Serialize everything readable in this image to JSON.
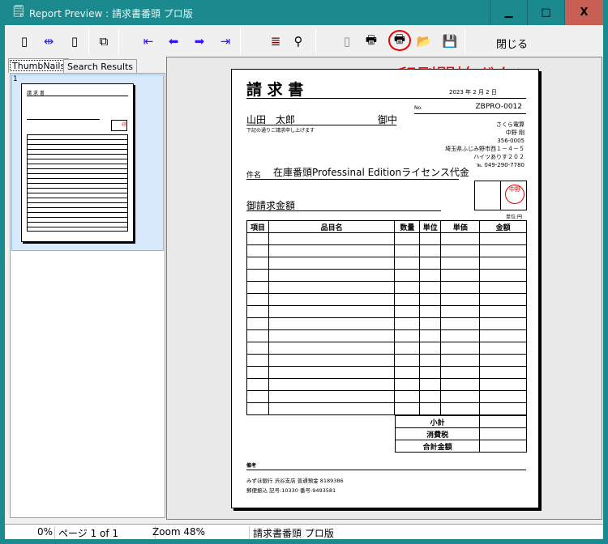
{
  "window": {
    "title": "Report Preview : 請求書番頭 プロ版",
    "minimize": "▁",
    "maximize": "□",
    "close": "X"
  },
  "toolbar": {
    "close_label": "閉じる",
    "annotation": "印刷開始ボタン",
    "annotation_color": "#ff0000"
  },
  "tabs": [
    {
      "label": "ThumbNails"
    },
    {
      "label": "Search Results"
    }
  ],
  "thumbnail": {
    "page_number": "1"
  },
  "invoice": {
    "title": "請 求 書",
    "date": "2023 年  2  月  2  日",
    "no_label": "No.",
    "no_value": "ZBPRO-0012",
    "customer": "山田　太郎",
    "honorific": "御中",
    "note": "下記の通りご請求申し上げます",
    "issuer": [
      "さくら電算",
      "中野 剛",
      "356-0005",
      "埼玉県ふじみ野市西１－４－５",
      "ハイツありす２０２",
      "℡ 049-290-7780"
    ],
    "stamp": "中野",
    "subject_label": "件名",
    "subject": "在庫番頭Professinal Editionライセンス代金",
    "amount_label": "御請求金額",
    "unit": "単位:円",
    "columns": [
      "項目",
      "品目名",
      "数量",
      "単位",
      "単価",
      "金額"
    ],
    "summary": [
      "小計",
      "消費税",
      "合計金額"
    ],
    "remarks_label": "備考",
    "bank": [
      "みずほ銀行  渋谷支店  普通預金  8189386",
      "郵便振込  記号:10330  番号:9493581"
    ]
  },
  "status": {
    "progress": "0%",
    "page": "ページ 1 of 1",
    "zoom": "Zoom 48%",
    "doc": "請求書番頭 プロ版"
  }
}
